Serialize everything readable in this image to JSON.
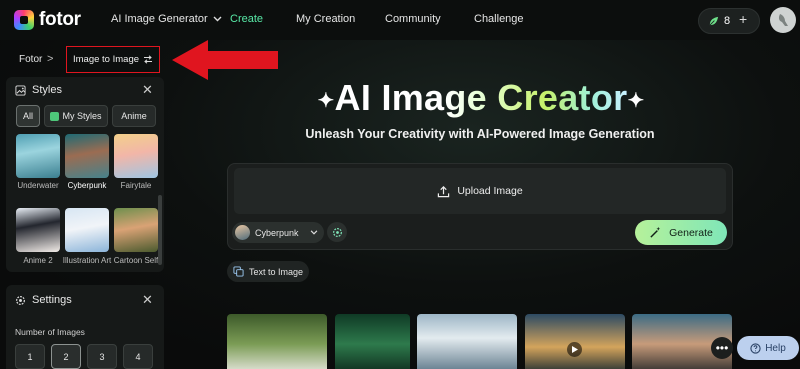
{
  "header": {
    "logo_text": "fotor",
    "nav": [
      {
        "label": "AI Image Generator"
      },
      {
        "label": "Create"
      },
      {
        "label": "My Creation"
      },
      {
        "label": "Community"
      },
      {
        "label": "Challenge"
      }
    ],
    "credits": "8",
    "accent": "#58e8a6"
  },
  "breadcrumb": {
    "home": "Fotor",
    "separator": ">",
    "current": "Image to Image"
  },
  "styles_panel": {
    "title": "Styles",
    "filters": [
      {
        "label": "All"
      },
      {
        "label": "My Styles"
      },
      {
        "label": "Anime"
      }
    ],
    "items": [
      {
        "label": "Underwater"
      },
      {
        "label": "Cyberpunk"
      },
      {
        "label": "Fairytale"
      },
      {
        "label": "Anime 2"
      },
      {
        "label": "Illustration Art"
      },
      {
        "label": "Cartoon Self"
      }
    ]
  },
  "settings_panel": {
    "title": "Settings",
    "number_label": "Number of Images",
    "numbers": [
      "1",
      "2",
      "3",
      "4"
    ],
    "selected_number": "2"
  },
  "hero": {
    "title_prefix": "AI Ima",
    "title_grad": "ge Creator",
    "subtitle": "Unleash Your Creativity with AI-Powered Image Generation"
  },
  "generator": {
    "upload_label": "Upload Image",
    "style_label": "Cyberpunk",
    "generate_label": "Generate",
    "generate_color": "#9fef9f"
  },
  "text_to_image_label": "Text to Image",
  "help_label": "Help",
  "annotation_color": "#e0151f"
}
